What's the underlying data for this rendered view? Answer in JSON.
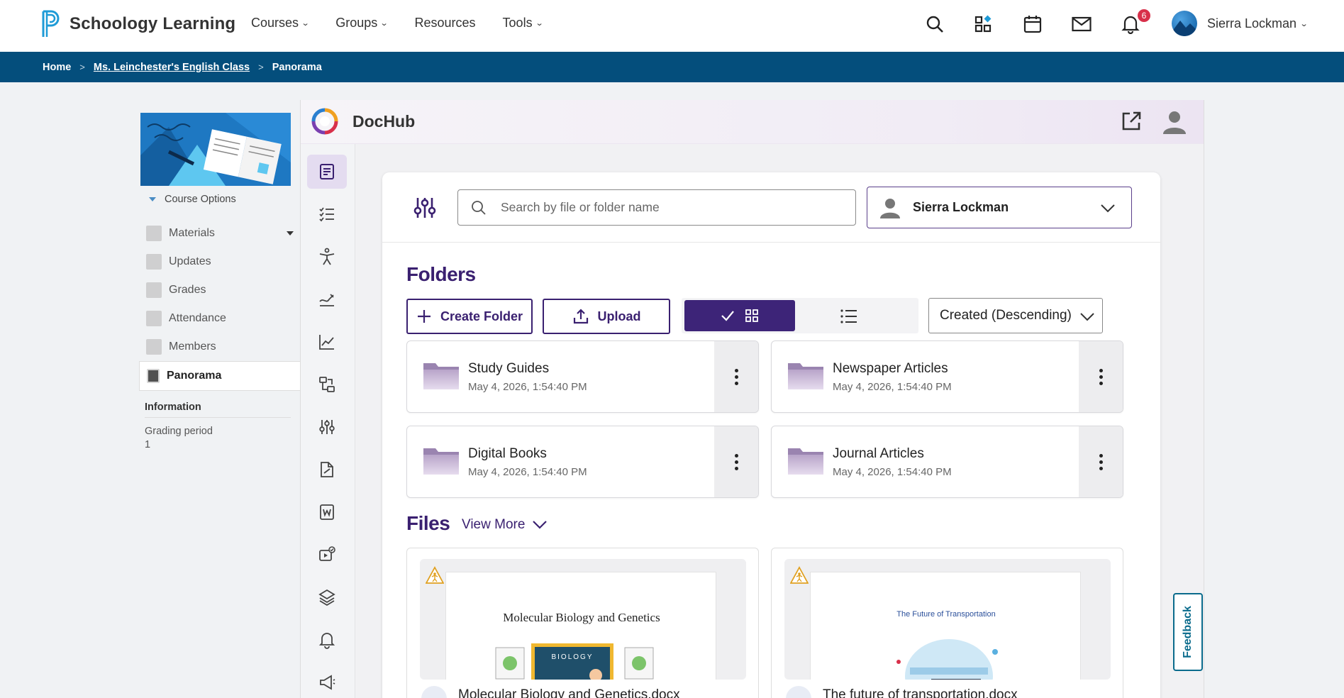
{
  "header": {
    "brand": "Schoology Learning",
    "nav": [
      {
        "label": "Courses",
        "has_menu": true
      },
      {
        "label": "Groups",
        "has_menu": true
      },
      {
        "label": "Resources",
        "has_menu": false
      },
      {
        "label": "Tools",
        "has_menu": true
      }
    ],
    "icons": [
      "search-icon",
      "apps-icon",
      "calendar-icon",
      "mail-icon",
      "bell-icon"
    ],
    "notification_count": "6",
    "user_name": "Sierra Lockman",
    "brand_color": "#1e9bd7"
  },
  "breadcrumb": {
    "home": "Home",
    "course": "Ms. Leinchester's English Class",
    "current": "Panorama",
    "separator": ">",
    "bg_color": "#044e7c"
  },
  "sidebar": {
    "course_options": "Course Options",
    "items": [
      {
        "label": "Materials",
        "active": false
      },
      {
        "label": "Updates",
        "active": false
      },
      {
        "label": "Grades",
        "active": false
      },
      {
        "label": "Attendance",
        "active": false
      },
      {
        "label": "Members",
        "active": false
      },
      {
        "label": "Panorama",
        "active": true
      }
    ],
    "info_title": "Information",
    "grading_label": "Grading period",
    "grading_value": "1"
  },
  "dochub": {
    "title": "DocHub",
    "rail_icons": [
      "documents-icon",
      "checklist-icon",
      "accessibility-icon",
      "signing-icon",
      "analytics-icon",
      "workflow-icon",
      "settings-sliders-icon",
      "file-edit-icon",
      "word-doc-icon",
      "video-check-icon",
      "layers-icon",
      "bell-icon",
      "megaphone-icon"
    ],
    "search_placeholder": "Search by file or folder name",
    "owner": "Sierra Lockman",
    "folders_title": "Folders",
    "create_folder": "Create Folder",
    "upload": "Upload",
    "sort": "Created (Descending)",
    "folders": [
      {
        "name": "Study Guides",
        "date": "May 4, 2026, 1:54:40 PM"
      },
      {
        "name": "Newspaper Articles",
        "date": "May 4, 2026, 1:54:40 PM"
      },
      {
        "name": "Digital Books",
        "date": "May 4, 2026, 1:54:40 PM"
      },
      {
        "name": "Journal Articles",
        "date": "May 4, 2026, 1:54:40 PM"
      }
    ],
    "files_title": "Files",
    "view_more": "View More",
    "files": [
      {
        "name": "Molecular Biology and Genetics.docx",
        "preview_title": "Molecular Biology and Genetics",
        "preview_sign": "BIOLOGY"
      },
      {
        "name": "The future of transportation.docx",
        "preview_title": "The Future of Transportation"
      }
    ],
    "accent_color": "#3a2070"
  },
  "feedback": "Feedback"
}
